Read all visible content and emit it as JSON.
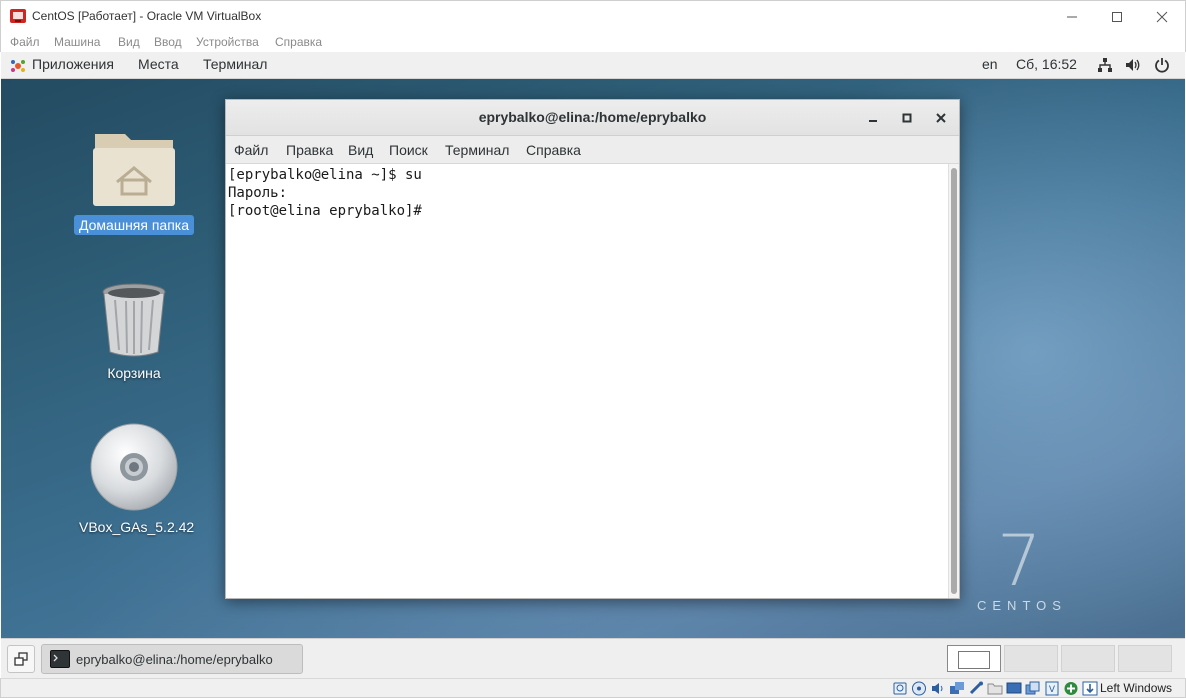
{
  "host_window": {
    "title": "CentOS [Работает] - Oracle VM VirtualBox",
    "menu": [
      "Файл",
      "Машина",
      "Вид",
      "Ввод",
      "Устройства",
      "Справка"
    ]
  },
  "gnome_panel": {
    "applications": "Приложения",
    "places": "Места",
    "terminal": "Терминал",
    "keyboard_layout": "en",
    "clock": "Сб, 16:52"
  },
  "desktop": {
    "icons": [
      {
        "label": "Домашняя папка",
        "icon": "home-folder-icon",
        "selected": true
      },
      {
        "label": "Корзина",
        "icon": "trash-icon",
        "selected": false
      },
      {
        "label": "VBox_GAs_5.2.42",
        "icon": "cd-disc-icon",
        "selected": false
      }
    ],
    "watermark": {
      "number": "7",
      "word": "CENTOS"
    }
  },
  "terminal": {
    "title": "eprybalko@elina:/home/eprybalko",
    "menu": [
      "Файл",
      "Правка",
      "Вид",
      "Поиск",
      "Терминал",
      "Справка"
    ],
    "lines": [
      "[eprybalko@elina ~]$ su",
      "Пароль:",
      "[root@elina eprybalko]#"
    ]
  },
  "window_list": {
    "task_label": "eprybalko@elina:/home/eprybalko",
    "workspaces": 4,
    "active_workspace": 1
  },
  "status_bar": {
    "host_key": "Left Windows"
  },
  "colors": {
    "selection": "#4a90d9",
    "vbox_red": "#d0261f"
  }
}
